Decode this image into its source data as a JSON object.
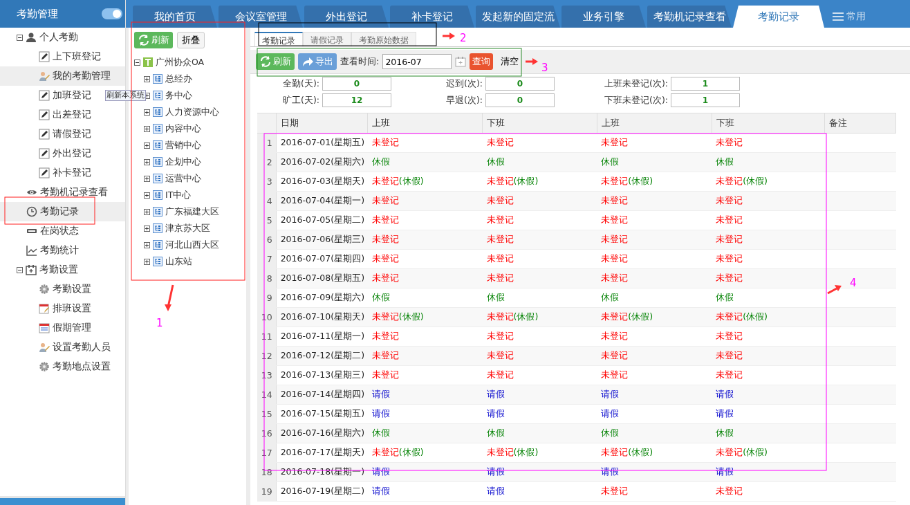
{
  "sidebar": {
    "title": "考勤管理",
    "toggle_on": true,
    "items": [
      {
        "label": "个人考勤",
        "kind": "person",
        "selected": false,
        "expanded": true,
        "children": [
          {
            "label": "上下班登记",
            "kind": "edit",
            "selected": false
          },
          {
            "label": "我的考勤管理",
            "kind": "user-edit",
            "selected": true
          },
          {
            "label": "加班登记",
            "kind": "edit",
            "selected": false
          },
          {
            "label": "出差登记",
            "kind": "edit",
            "selected": false
          },
          {
            "label": "请假登记",
            "kind": "edit",
            "selected": false
          },
          {
            "label": "外出登记",
            "kind": "edit",
            "selected": false
          },
          {
            "label": "补卡登记",
            "kind": "edit",
            "selected": false
          }
        ]
      },
      {
        "label": "考勤机记录查看",
        "kind": "eye",
        "selected": false
      },
      {
        "label": "考勤记录",
        "kind": "clock",
        "selected": true
      },
      {
        "label": "在岗状态",
        "kind": "card",
        "selected": false
      },
      {
        "label": "考勤统计",
        "kind": "chart",
        "selected": false
      },
      {
        "label": "考勤设置",
        "kind": "calendar",
        "selected": false,
        "expanded": true,
        "children": [
          {
            "label": "考勤设置",
            "kind": "gear",
            "selected": false
          },
          {
            "label": "排班设置",
            "kind": "schedule",
            "selected": false
          },
          {
            "label": "假期管理",
            "kind": "holiday",
            "selected": false
          },
          {
            "label": "设置考勤人员",
            "kind": "user-edit",
            "selected": false
          },
          {
            "label": "考勤地点设置",
            "kind": "gear",
            "selected": false
          }
        ]
      }
    ]
  },
  "tabs": [
    {
      "label": "我的首页",
      "selected": false
    },
    {
      "label": "会议室管理",
      "selected": false
    },
    {
      "label": "外出登记",
      "selected": false
    },
    {
      "label": "补卡登记",
      "selected": false
    },
    {
      "label": "发起新的固定流",
      "selected": false
    },
    {
      "label": "业务引擎",
      "selected": false
    },
    {
      "label": "考勤机记录查看",
      "selected": false
    },
    {
      "label": "考勤记录",
      "selected": true
    }
  ],
  "tabs_menu": "常用",
  "org_tree": {
    "refresh": "刷新",
    "collapse": "折叠",
    "root": {
      "label": "广州协众OA",
      "expanded": true,
      "children": [
        {
          "label": "总经办",
          "expanded": false
        },
        {
          "label": "务中心",
          "expanded": false
        },
        {
          "label": "人力资源中心",
          "expanded": false
        },
        {
          "label": "内容中心",
          "expanded": false
        },
        {
          "label": "营销中心",
          "expanded": false
        },
        {
          "label": "企划中心",
          "expanded": false
        },
        {
          "label": "运营中心",
          "expanded": false
        },
        {
          "label": "IT中心",
          "expanded": false
        },
        {
          "label": "广东福建大区",
          "expanded": false
        },
        {
          "label": "津京苏大区",
          "expanded": false
        },
        {
          "label": "河北山西大区",
          "expanded": false
        },
        {
          "label": "山东站",
          "expanded": false
        }
      ]
    }
  },
  "tooltip": "刷新本系统",
  "sub_tabs": [
    {
      "label": "考勤记录",
      "selected": true
    },
    {
      "label": "请假记录",
      "selected": false
    },
    {
      "label": "考勤原始数据",
      "selected": false
    }
  ],
  "toolbar": {
    "refresh": "刷新",
    "export": "导出",
    "time_label": "查看时间:",
    "time_value": "2016-07",
    "query": "查询",
    "clear": "清空"
  },
  "stats": [
    {
      "label": "全勤(天):",
      "value": "0"
    },
    {
      "label": "迟到(次):",
      "value": "0"
    },
    {
      "label": "上班未登记(次):",
      "value": "1"
    },
    {
      "label": "旷工(天):",
      "value": "12"
    },
    {
      "label": "早退(次):",
      "value": "0"
    },
    {
      "label": "下班未登记(次):",
      "value": "1"
    }
  ],
  "table": {
    "columns": [
      "",
      "日期",
      "上班",
      "下班",
      "上班",
      "下班",
      "备注"
    ],
    "rows": [
      {
        "cells": [
          [
            {
              "text": "1",
              "kind": "num"
            }
          ],
          [
            {
              "text": "2016-07-01(星期五)",
              "kind": "date"
            }
          ],
          [
            {
              "text": "未登记",
              "kind": "missing"
            }
          ],
          [
            {
              "text": "未登记",
              "kind": "missing"
            }
          ],
          [
            {
              "text": "未登记",
              "kind": "missing"
            }
          ],
          [
            {
              "text": "未登记",
              "kind": "missing"
            }
          ]
        ]
      },
      {
        "cells": [
          [
            {
              "text": "2",
              "kind": "num"
            }
          ],
          [
            {
              "text": "2016-07-02(星期六)",
              "kind": "date"
            }
          ],
          [
            {
              "text": "休假",
              "kind": "holiday"
            }
          ],
          [
            {
              "text": "休假",
              "kind": "holiday"
            }
          ],
          [
            {
              "text": "休假",
              "kind": "holiday"
            }
          ],
          [
            {
              "text": "休假",
              "kind": "holiday"
            }
          ]
        ]
      },
      {
        "cells": [
          [
            {
              "text": "3",
              "kind": "num"
            }
          ],
          [
            {
              "text": "2016-07-03(星期天)",
              "kind": "date"
            }
          ],
          [
            {
              "text": "未登记",
              "kind": "missing"
            },
            {
              "text": "(休假)",
              "kind": "holiday"
            }
          ],
          [
            {
              "text": "未登记",
              "kind": "missing"
            },
            {
              "text": "(休假)",
              "kind": "holiday"
            }
          ],
          [
            {
              "text": "未登记",
              "kind": "missing"
            },
            {
              "text": "(休假)",
              "kind": "holiday"
            }
          ],
          [
            {
              "text": "未登记",
              "kind": "missing"
            },
            {
              "text": "(休假)",
              "kind": "holiday"
            }
          ]
        ]
      },
      {
        "cells": [
          [
            {
              "text": "4",
              "kind": "num"
            }
          ],
          [
            {
              "text": "2016-07-04(星期一)",
              "kind": "date"
            }
          ],
          [
            {
              "text": "未登记",
              "kind": "missing"
            }
          ],
          [
            {
              "text": "未登记",
              "kind": "missing"
            }
          ],
          [
            {
              "text": "未登记",
              "kind": "missing"
            }
          ],
          [
            {
              "text": "未登记",
              "kind": "missing"
            }
          ]
        ]
      },
      {
        "cells": [
          [
            {
              "text": "5",
              "kind": "num"
            }
          ],
          [
            {
              "text": "2016-07-05(星期二)",
              "kind": "date"
            }
          ],
          [
            {
              "text": "未登记",
              "kind": "missing"
            }
          ],
          [
            {
              "text": "未登记",
              "kind": "missing"
            }
          ],
          [
            {
              "text": "未登记",
              "kind": "missing"
            }
          ],
          [
            {
              "text": "未登记",
              "kind": "missing"
            }
          ]
        ]
      },
      {
        "cells": [
          [
            {
              "text": "6",
              "kind": "num"
            }
          ],
          [
            {
              "text": "2016-07-06(星期三)",
              "kind": "date"
            }
          ],
          [
            {
              "text": "未登记",
              "kind": "missing"
            }
          ],
          [
            {
              "text": "未登记",
              "kind": "missing"
            }
          ],
          [
            {
              "text": "未登记",
              "kind": "missing"
            }
          ],
          [
            {
              "text": "未登记",
              "kind": "missing"
            }
          ]
        ]
      },
      {
        "cells": [
          [
            {
              "text": "7",
              "kind": "num"
            }
          ],
          [
            {
              "text": "2016-07-07(星期四)",
              "kind": "date"
            }
          ],
          [
            {
              "text": "未登记",
              "kind": "missing"
            }
          ],
          [
            {
              "text": "未登记",
              "kind": "missing"
            }
          ],
          [
            {
              "text": "未登记",
              "kind": "missing"
            }
          ],
          [
            {
              "text": "未登记",
              "kind": "missing"
            }
          ]
        ]
      },
      {
        "cells": [
          [
            {
              "text": "8",
              "kind": "num"
            }
          ],
          [
            {
              "text": "2016-07-08(星期五)",
              "kind": "date"
            }
          ],
          [
            {
              "text": "未登记",
              "kind": "missing"
            }
          ],
          [
            {
              "text": "未登记",
              "kind": "missing"
            }
          ],
          [
            {
              "text": "未登记",
              "kind": "missing"
            }
          ],
          [
            {
              "text": "未登记",
              "kind": "missing"
            }
          ]
        ]
      },
      {
        "cells": [
          [
            {
              "text": "9",
              "kind": "num"
            }
          ],
          [
            {
              "text": "2016-07-09(星期六)",
              "kind": "date"
            }
          ],
          [
            {
              "text": "休假",
              "kind": "holiday"
            }
          ],
          [
            {
              "text": "休假",
              "kind": "holiday"
            }
          ],
          [
            {
              "text": "休假",
              "kind": "holiday"
            }
          ],
          [
            {
              "text": "休假",
              "kind": "holiday"
            }
          ]
        ]
      },
      {
        "cells": [
          [
            {
              "text": "10",
              "kind": "num"
            }
          ],
          [
            {
              "text": "2016-07-10(星期天)",
              "kind": "date"
            }
          ],
          [
            {
              "text": "未登记",
              "kind": "missing"
            },
            {
              "text": "(休假)",
              "kind": "holiday"
            }
          ],
          [
            {
              "text": "未登记",
              "kind": "missing"
            },
            {
              "text": "(休假)",
              "kind": "holiday"
            }
          ],
          [
            {
              "text": "未登记",
              "kind": "missing"
            },
            {
              "text": "(休假)",
              "kind": "holiday"
            }
          ],
          [
            {
              "text": "未登记",
              "kind": "missing"
            },
            {
              "text": "(休假)",
              "kind": "holiday"
            }
          ]
        ]
      },
      {
        "cells": [
          [
            {
              "text": "11",
              "kind": "num"
            }
          ],
          [
            {
              "text": "2016-07-11(星期一)",
              "kind": "date"
            }
          ],
          [
            {
              "text": "未登记",
              "kind": "missing"
            }
          ],
          [
            {
              "text": "未登记",
              "kind": "missing"
            }
          ],
          [
            {
              "text": "未登记",
              "kind": "missing"
            }
          ],
          [
            {
              "text": "未登记",
              "kind": "missing"
            }
          ]
        ]
      },
      {
        "cells": [
          [
            {
              "text": "12",
              "kind": "num"
            }
          ],
          [
            {
              "text": "2016-07-12(星期二)",
              "kind": "date"
            }
          ],
          [
            {
              "text": "未登记",
              "kind": "missing"
            }
          ],
          [
            {
              "text": "未登记",
              "kind": "missing"
            }
          ],
          [
            {
              "text": "未登记",
              "kind": "missing"
            }
          ],
          [
            {
              "text": "未登记",
              "kind": "missing"
            }
          ]
        ]
      },
      {
        "cells": [
          [
            {
              "text": "13",
              "kind": "num"
            }
          ],
          [
            {
              "text": "2016-07-13(星期三)",
              "kind": "date"
            }
          ],
          [
            {
              "text": "未登记",
              "kind": "missing"
            }
          ],
          [
            {
              "text": "未登记",
              "kind": "missing"
            }
          ],
          [
            {
              "text": "未登记",
              "kind": "missing"
            }
          ],
          [
            {
              "text": "未登记",
              "kind": "missing"
            }
          ]
        ]
      },
      {
        "cells": [
          [
            {
              "text": "14",
              "kind": "num"
            }
          ],
          [
            {
              "text": "2016-07-14(星期四)",
              "kind": "date"
            }
          ],
          [
            {
              "text": "请假",
              "kind": "leave"
            }
          ],
          [
            {
              "text": "请假",
              "kind": "leave"
            }
          ],
          [
            {
              "text": "请假",
              "kind": "leave"
            }
          ],
          [
            {
              "text": "请假",
              "kind": "leave"
            }
          ]
        ]
      },
      {
        "cells": [
          [
            {
              "text": "15",
              "kind": "num"
            }
          ],
          [
            {
              "text": "2016-07-15(星期五)",
              "kind": "date"
            }
          ],
          [
            {
              "text": "请假",
              "kind": "leave"
            }
          ],
          [
            {
              "text": "请假",
              "kind": "leave"
            }
          ],
          [
            {
              "text": "请假",
              "kind": "leave"
            }
          ],
          [
            {
              "text": "请假",
              "kind": "leave"
            }
          ]
        ]
      },
      {
        "cells": [
          [
            {
              "text": "16",
              "kind": "num"
            }
          ],
          [
            {
              "text": "2016-07-16(星期六)",
              "kind": "date"
            }
          ],
          [
            {
              "text": "休假",
              "kind": "holiday"
            }
          ],
          [
            {
              "text": "休假",
              "kind": "holiday"
            }
          ],
          [
            {
              "text": "休假",
              "kind": "holiday"
            }
          ],
          [
            {
              "text": "休假",
              "kind": "holiday"
            }
          ]
        ]
      },
      {
        "cells": [
          [
            {
              "text": "17",
              "kind": "num"
            }
          ],
          [
            {
              "text": "2016-07-17(星期天)",
              "kind": "date"
            }
          ],
          [
            {
              "text": "未登记",
              "kind": "missing"
            },
            {
              "text": "(休假)",
              "kind": "holiday"
            }
          ],
          [
            {
              "text": "未登记",
              "kind": "missing"
            },
            {
              "text": "(休假)",
              "kind": "holiday"
            }
          ],
          [
            {
              "text": "未登记",
              "kind": "missing"
            },
            {
              "text": "(休假)",
              "kind": "holiday"
            }
          ],
          [
            {
              "text": "未登记",
              "kind": "missing"
            },
            {
              "text": "(休假)",
              "kind": "holiday"
            }
          ]
        ]
      },
      {
        "cells": [
          [
            {
              "text": "18",
              "kind": "num"
            }
          ],
          [
            {
              "text": "2016-07-18(星期一)",
              "kind": "date"
            }
          ],
          [
            {
              "text": "请假",
              "kind": "leave"
            }
          ],
          [
            {
              "text": "请假",
              "kind": "leave"
            }
          ],
          [
            {
              "text": "请假",
              "kind": "leave"
            }
          ],
          [
            {
              "text": "请假",
              "kind": "leave"
            }
          ]
        ]
      },
      {
        "cells": [
          [
            {
              "text": "19",
              "kind": "num"
            }
          ],
          [
            {
              "text": "2016-07-19(星期二)",
              "kind": "date"
            }
          ],
          [
            {
              "text": "请假",
              "kind": "leave"
            }
          ],
          [
            {
              "text": "请假",
              "kind": "leave"
            }
          ],
          [
            {
              "text": "未登记",
              "kind": "missing"
            }
          ],
          [
            {
              "text": "未登记",
              "kind": "missing"
            }
          ]
        ]
      }
    ]
  },
  "annotations": [
    {
      "label": "1"
    },
    {
      "label": "2"
    },
    {
      "label": "3"
    },
    {
      "label": "4"
    }
  ]
}
